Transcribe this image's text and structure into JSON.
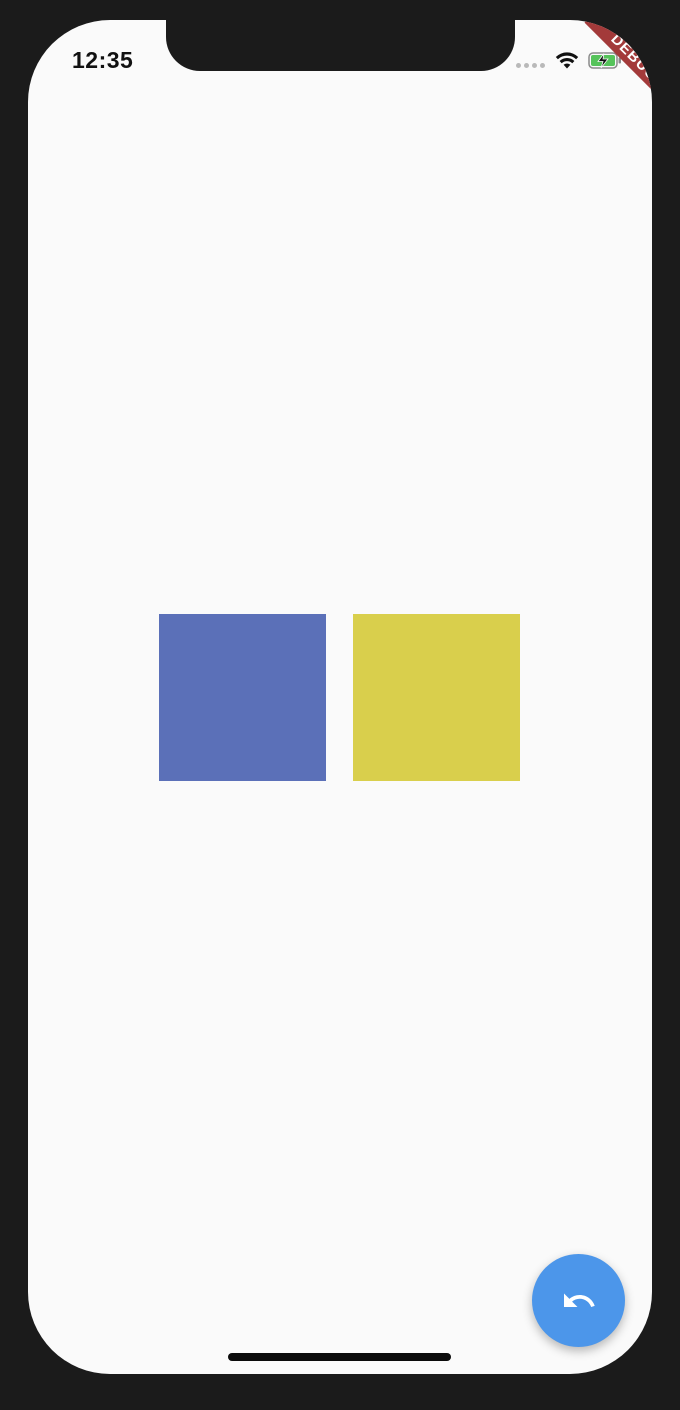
{
  "status_bar": {
    "time": "12:35",
    "icons": [
      "signal-dots-icon",
      "wifi-icon",
      "battery-charging-icon"
    ]
  },
  "debug_banner": {
    "label": "DEBUG",
    "color": "#a33a3a"
  },
  "main": {
    "squares": [
      {
        "color": "#5b70b8"
      },
      {
        "color": "#d9cf4c"
      }
    ]
  },
  "fab": {
    "icon": "undo-icon",
    "color": "#4c96ea"
  },
  "colors": {
    "background": "#fafafa",
    "frame": "#1b1b1b"
  }
}
